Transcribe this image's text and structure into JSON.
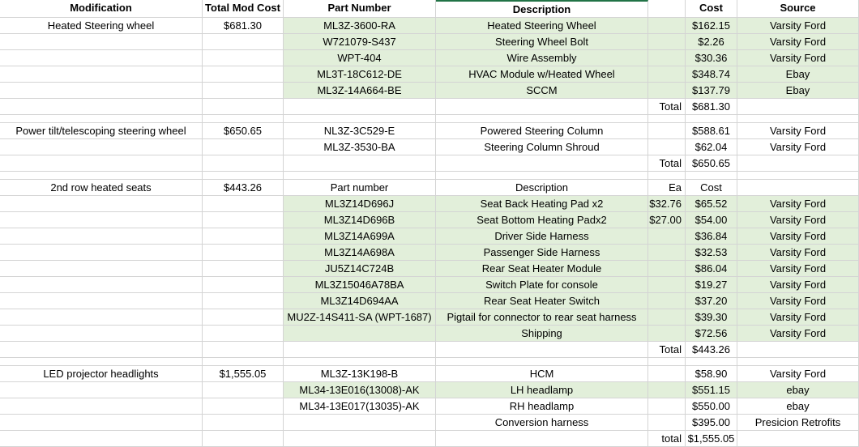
{
  "header": [
    "Modification",
    "Total Mod Cost",
    "Part Number",
    "Description",
    "",
    "Cost",
    "Source"
  ],
  "rows": [
    {
      "mod": "Heated Steering wheel",
      "total": "$681.30",
      "part": "ML3Z-3600-RA",
      "desc": "Heated Steering Wheel",
      "ea": "",
      "cost": "$162.15",
      "src": "Varsity Ford",
      "green": true
    },
    {
      "mod": "",
      "total": "",
      "part": "W721079-S437",
      "desc": "Steering Wheel Bolt",
      "ea": "",
      "cost": "$2.26",
      "src": "Varsity Ford",
      "green": true
    },
    {
      "mod": "",
      "total": "",
      "part": "WPT-404",
      "desc": "Wire Assembly",
      "ea": "",
      "cost": "$30.36",
      "src": "Varsity Ford",
      "green": true
    },
    {
      "mod": "",
      "total": "",
      "part": "ML3T-18C612-DE",
      "desc": "HVAC Module w/Heated Wheel",
      "ea": "",
      "cost": "$348.74",
      "src": "Ebay",
      "green": true
    },
    {
      "mod": "",
      "total": "",
      "part": "ML3Z-14A664-BE",
      "desc": "SCCM",
      "ea": "",
      "cost": "$137.79",
      "src": "Ebay",
      "green": true
    },
    {
      "mod": "",
      "total": "",
      "part": "",
      "desc": "",
      "ea": "Total",
      "cost": "$681.30",
      "src": "",
      "green": false,
      "totalRow": true
    },
    {
      "mod": "",
      "total": "",
      "part": "",
      "desc": "",
      "ea": "",
      "cost": "",
      "src": "",
      "green": false,
      "spacer": true
    },
    {
      "mod": "Power tilt/telescoping steering wheel",
      "total": "$650.65",
      "part": "NL3Z-3C529-E",
      "desc": "Powered Steering Column",
      "ea": "",
      "cost": "$588.61",
      "src": "Varsity Ford",
      "green": false
    },
    {
      "mod": "",
      "total": "",
      "part": "ML3Z-3530-BA",
      "desc": "Steering Column Shroud",
      "ea": "",
      "cost": "$62.04",
      "src": "Varsity Ford",
      "green": false
    },
    {
      "mod": "",
      "total": "",
      "part": "",
      "desc": "",
      "ea": "Total",
      "cost": "$650.65",
      "src": "",
      "green": false,
      "totalRow": true
    },
    {
      "mod": "",
      "total": "",
      "part": "",
      "desc": "",
      "ea": "",
      "cost": "",
      "src": "",
      "green": false,
      "spacer": true
    },
    {
      "mod": "2nd row heated seats",
      "total": "$443.26",
      "part": "Part number",
      "desc": "Description",
      "ea": "Ea",
      "cost": "Cost",
      "src": "",
      "green": false,
      "subheader": true
    },
    {
      "mod": "",
      "total": "",
      "part": "ML3Z14D696J",
      "desc": "Seat Back Heating Pad x2",
      "ea": "$32.76",
      "cost": "$65.52",
      "src": "Varsity Ford",
      "green": true
    },
    {
      "mod": "",
      "total": "",
      "part": "ML3Z14D696B",
      "desc": "Seat Bottom Heating Padx2",
      "ea": "$27.00",
      "cost": "$54.00",
      "src": "Varsity Ford",
      "green": true
    },
    {
      "mod": "",
      "total": "",
      "part": "ML3Z14A699A",
      "desc": "Driver Side Harness",
      "ea": "",
      "cost": "$36.84",
      "src": "Varsity Ford",
      "green": true
    },
    {
      "mod": "",
      "total": "",
      "part": "ML3Z14A698A",
      "desc": "Passenger Side Harness",
      "ea": "",
      "cost": "$32.53",
      "src": "Varsity Ford",
      "green": true
    },
    {
      "mod": "",
      "total": "",
      "part": "JU5Z14C724B",
      "desc": "Rear Seat Heater Module",
      "ea": "",
      "cost": "$86.04",
      "src": "Varsity Ford",
      "green": true
    },
    {
      "mod": "",
      "total": "",
      "part": "ML3Z15046A78BA",
      "desc": "Switch Plate for console",
      "ea": "",
      "cost": "$19.27",
      "src": "Varsity Ford",
      "green": true
    },
    {
      "mod": "",
      "total": "",
      "part": "ML3Z14D694AA",
      "desc": "Rear Seat Heater Switch",
      "ea": "",
      "cost": "$37.20",
      "src": "Varsity Ford",
      "green": true
    },
    {
      "mod": "",
      "total": "",
      "part": "MU2Z-14S411-SA (WPT-1687)",
      "desc": "Pigtail for connector to rear seat harness",
      "ea": "",
      "cost": "$39.30",
      "src": "Varsity Ford",
      "green": true
    },
    {
      "mod": "",
      "total": "",
      "part": "",
      "desc": "Shipping",
      "ea": "",
      "cost": "$72.56",
      "src": "Varsity Ford",
      "green": true
    },
    {
      "mod": "",
      "total": "",
      "part": "",
      "desc": "",
      "ea": "Total",
      "cost": "$443.26",
      "src": "",
      "green": false,
      "totalRow": true
    },
    {
      "mod": "",
      "total": "",
      "part": "",
      "desc": "",
      "ea": "",
      "cost": "",
      "src": "",
      "green": false,
      "spacer": true
    },
    {
      "mod": "LED projector headlights",
      "total": "$1,555.05",
      "part": "ML3Z-13K198-B",
      "desc": "HCM",
      "ea": "",
      "cost": "$58.90",
      "src": "Varsity Ford",
      "green": false
    },
    {
      "mod": "",
      "total": "",
      "part": "ML34-13E016(13008)-AK",
      "desc": "LH headlamp",
      "ea": "",
      "cost": "$551.15",
      "src": "ebay",
      "green": true
    },
    {
      "mod": "",
      "total": "",
      "part": "ML34-13E017(13035)-AK",
      "desc": "RH headlamp",
      "ea": "",
      "cost": "$550.00",
      "src": "ebay",
      "green": false
    },
    {
      "mod": "",
      "total": "",
      "part": "",
      "desc": "Conversion harness",
      "ea": "",
      "cost": "$395.00",
      "src": "Presicion Retrofits",
      "green": false
    },
    {
      "mod": "",
      "total": "",
      "part": "",
      "desc": "",
      "ea": "total",
      "cost": "$1,555.05",
      "src": "",
      "green": false,
      "totalRow": true
    }
  ],
  "colors": {
    "green": "#e2efda",
    "grid": "#d4d4d4",
    "selection": "#217346"
  }
}
